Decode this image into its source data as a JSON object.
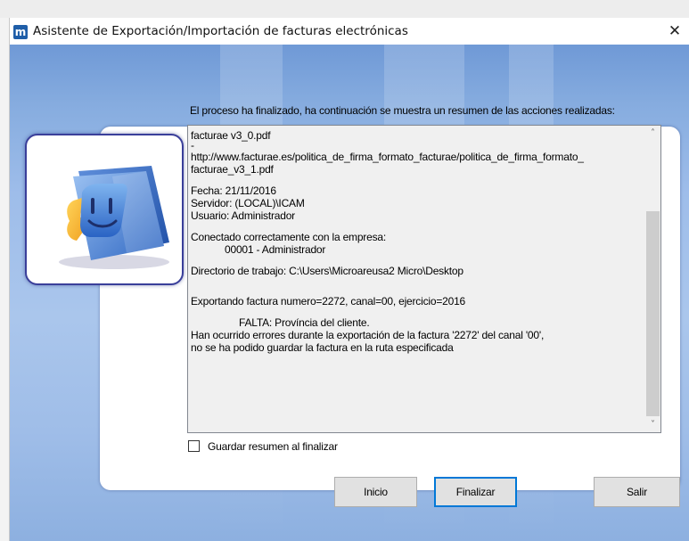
{
  "window": {
    "title": "Asistente de Exportación/Importación de facturas electrónicas",
    "app_icon": "m",
    "close_glyph": "✕"
  },
  "main": {
    "heading": "El proceso ha finalizado, ha continuación se muestra un resumen de las acciones realizadas:",
    "summary_lines": [
      "facturae v3_0.pdf",
      " -",
      "http://www.facturae.es/politica_de_firma_formato_facturae/politica_de_firma_formato_",
      "facturae_v3_1.pdf",
      "",
      "Fecha: 21/11/2016",
      "Servidor: (LOCAL)\\ICAM",
      "Usuario: Administrador",
      "",
      "Conectado correctamente con la empresa:",
      "00001 -  Administrador",
      "",
      "Directorio de trabajo: C:\\Users\\Microareusa2 Micro\\Desktop",
      "",
      "",
      "Exportando factura numero=2272, canal=00, ejercicio=2016",
      "",
      "FALTA: Província del cliente.",
      "Han ocurrido errores durante la exportación de la factura '2272' del canal '00',",
      "no se ha podido guardar la factura en la ruta especificada"
    ],
    "checkbox_label": "Guardar resumen al finalizar",
    "checkbox_checked": false
  },
  "buttons": {
    "inicio": "Inicio",
    "finalizar": "Finalizar",
    "salir": "Salir"
  },
  "icons": {
    "logo": "finder-folder-icon",
    "scroll_up": "chevron-up-icon",
    "scroll_down": "chevron-down-icon"
  },
  "colors": {
    "accent": "#0078d7",
    "panel_border": "#3a3f9a",
    "client_blue": "#9ebdea"
  }
}
